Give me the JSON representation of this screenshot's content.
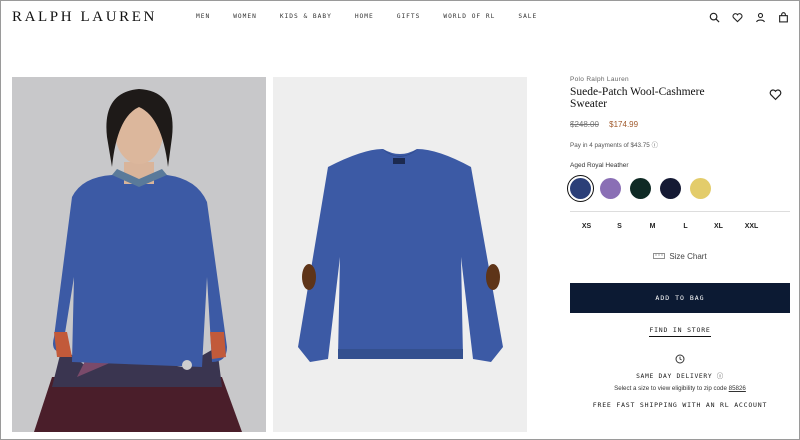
{
  "header": {
    "logo": "RALPH LAUREN",
    "nav": [
      "MEN",
      "WOMEN",
      "KIDS & BABY",
      "HOME",
      "GIFTS",
      "WORLD OF RL",
      "SALE"
    ],
    "icons": [
      "search-icon",
      "heart-icon",
      "user-icon",
      "bag-icon"
    ]
  },
  "product": {
    "brand": "Polo Ralph Lauren",
    "title": "Suede-Patch Wool-Cashmere Sweater",
    "price_original": "$248.00",
    "price_sale": "$174.99",
    "installments": "Pay in 4 payments of $43.75",
    "selected_color": "Aged Royal Heather",
    "swatches": [
      "#2b3f78",
      "#8a6fb5",
      "#0f2a25",
      "#151a34",
      "#e3cc6a"
    ],
    "sizes": [
      "XS",
      "S",
      "M",
      "L",
      "XL",
      "XXL"
    ],
    "size_chart": "Size Chart",
    "add_to_bag": "ADD TO BAG",
    "find_in_store": "FIND IN STORE",
    "same_day": "SAME DAY DELIVERY",
    "eligibility": "Select a size to view eligibility to zip code",
    "zip": "85826",
    "free_shipping": "FREE FAST SHIPPING WITH AN RL ACCOUNT"
  },
  "colors": {
    "sweater": "#3c5aa5",
    "button": "#0c1a33",
    "sale_price": "#a05a2c"
  }
}
